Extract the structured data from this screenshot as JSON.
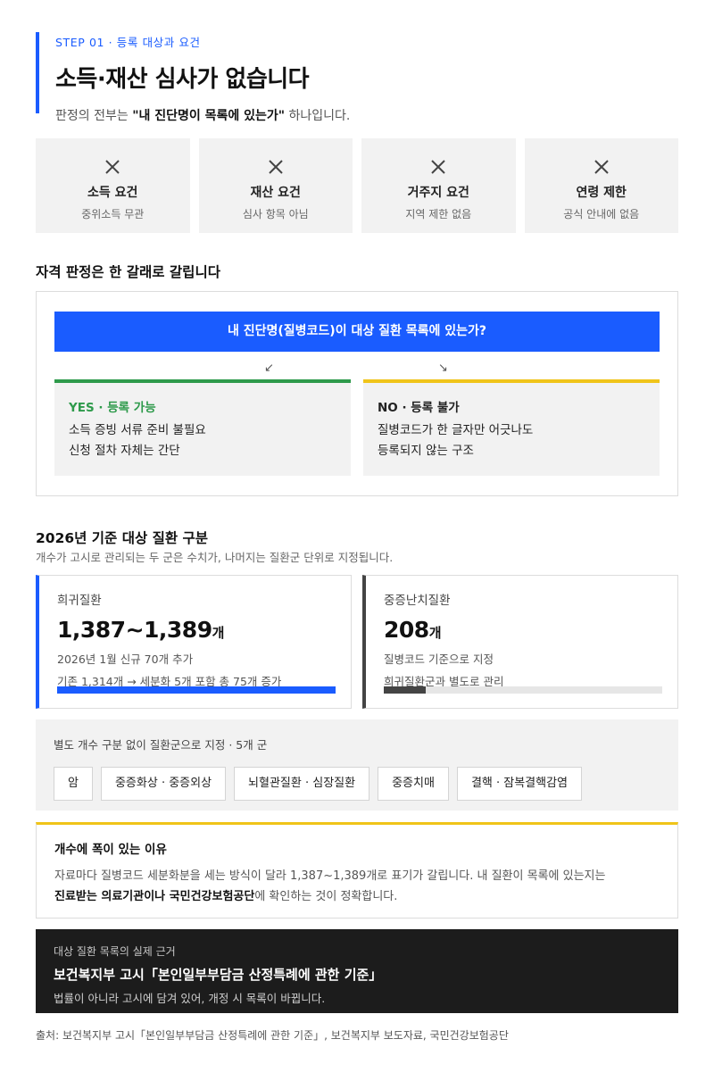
{
  "header": {
    "step": "STEP 01 · 등록 대상과 요건",
    "title": "소득·재산 심사가 없습니다",
    "subtitle_pre": "판정의 전부는 ",
    "subtitle_bold": "\"내 진단명이 목록에 있는가\"",
    "subtitle_post": " 하나입니다."
  },
  "requirements": [
    {
      "icon": "close-icon",
      "title": "소득 요건",
      "desc": "중위소득 무관"
    },
    {
      "icon": "close-icon",
      "title": "재산 요건",
      "desc": "심사 항목 아님"
    },
    {
      "icon": "close-icon",
      "title": "거주지 요건",
      "desc": "지역 제한 없음"
    },
    {
      "icon": "close-icon",
      "title": "연령 제한",
      "desc": "공식 안내에 없음"
    }
  ],
  "decision": {
    "section_title": "자격 판정은 한 갈래로 갈립니다",
    "question": "내 진단명(질병코드)이 대상 질환 목록에 있는가?",
    "arrow_left": "↙",
    "arrow_right": "↘",
    "yes": {
      "heading": "YES · 등록 가능",
      "line1": "소득 증빙 서류 준비 불필요",
      "line2": "신청 절차 자체는 간단"
    },
    "no": {
      "heading": "NO · 등록 불가",
      "line1": "질병코드가 한 글자만 어긋나도",
      "line2": "등록되지 않는 구조"
    }
  },
  "diseases": {
    "section_title": "2026년 기준 대상 질환 구분",
    "section_sub": "개수가 고시로 관리되는 두 군은 수치가, 나머지는 질환군 단위로 지정됩니다.",
    "rare": {
      "label": "희귀질환",
      "value": "1,387~1,389",
      "unit": "개",
      "note1": "2026년 1월 신규 70개 추가",
      "note2": "기존 1,314개 → 세분화 5개 포함 총 75개 증가",
      "bar_fraction": 1.0
    },
    "intractable": {
      "label": "중증난치질환",
      "value": "208",
      "unit": "개",
      "note1": "질병코드 기준으로 지정",
      "note2": "희귀질환군과 별도로 관리",
      "bar_fraction": 0.15
    }
  },
  "groups": {
    "title": "별도 개수 구분 없이 질환군으로 지정 · 5개 군",
    "chips": [
      "암",
      "중증화상 · 중증외상",
      "뇌혈관질환 · 심장질환",
      "중증치매",
      "결핵 · 잠복결핵감염"
    ]
  },
  "note": {
    "title": "개수에 폭이 있는 이유",
    "body1": "자료마다 질병코드 세분화분을 세는 방식이 달라 1,387~1,389개로 표기가 갈립니다. 내 질환이 목록에 있는지는",
    "body2_bold": "진료받는 의료기관이나 국민건강보험공단",
    "body2_post": "에 확인하는 것이 정확합니다."
  },
  "basis": {
    "label": "대상 질환 목록의 실제 근거",
    "title": "보건복지부 고시「본인일부부담금 산정특례에 관한 기준」",
    "desc": "법률이 아니라 고시에 담겨 있어, 개정 시 목록이 바뀝니다."
  },
  "source": "출처: 보건복지부 고시「본인일부부담금 산정특례에 관한 기준」, 보건복지부 보도자료, 국민건강보험공단",
  "colors": {
    "accent": "#1a5cff",
    "yes": "#2e9a4b",
    "no": "#f0c419",
    "dark": "#1c1c1c"
  }
}
